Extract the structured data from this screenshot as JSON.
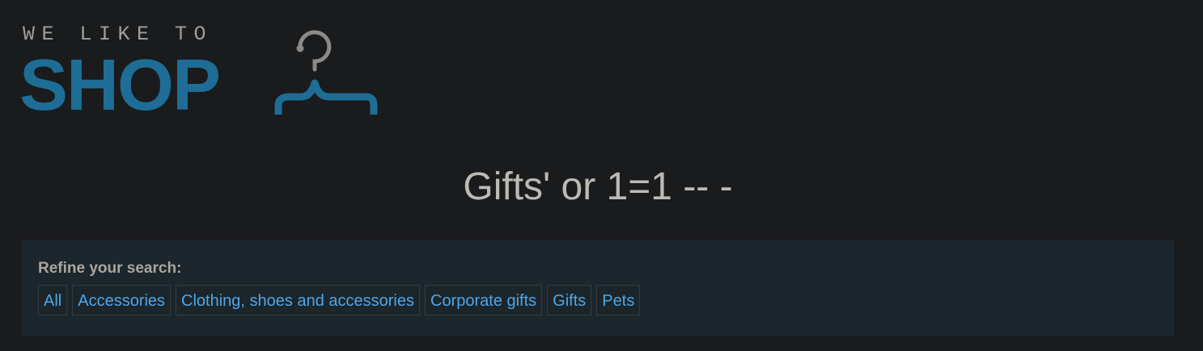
{
  "logo": {
    "tagline": "WE LIKE TO",
    "word": "SHOP",
    "icon": "hanger-icon"
  },
  "page": {
    "title": "Gifts' or 1=1 -- -"
  },
  "filter": {
    "label": "Refine your search:",
    "categories": [
      {
        "label": "All"
      },
      {
        "label": "Accessories"
      },
      {
        "label": "Clothing, shoes and accessories"
      },
      {
        "label": "Corporate gifts"
      },
      {
        "label": "Gifts"
      },
      {
        "label": "Pets"
      }
    ]
  },
  "colors": {
    "background": "#1a1b1d",
    "brand_blue": "#1e6d96",
    "link_blue": "#4ea6ea",
    "panel": "#1d262c",
    "title_text": "#bdbab4"
  }
}
